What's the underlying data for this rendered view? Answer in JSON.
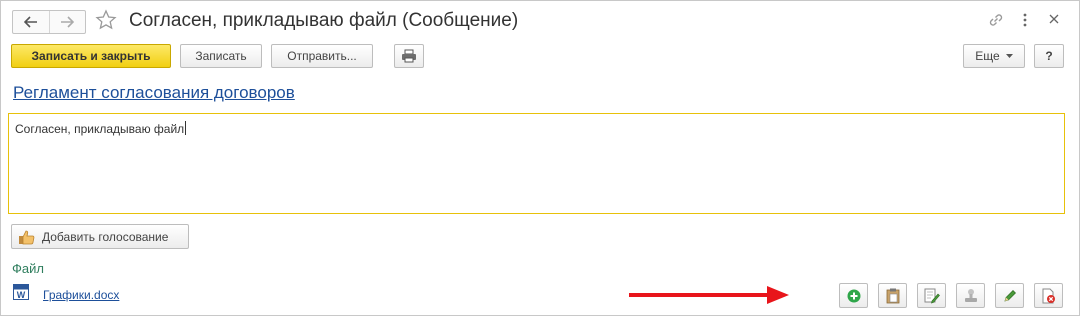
{
  "window": {
    "title": "Согласен, прикладываю файл (Сообщение)"
  },
  "toolbar": {
    "save_close_label": "Записать и закрыть",
    "save_label": "Записать",
    "send_label": "Отправить...",
    "more_label": "Еще",
    "help_label": "?"
  },
  "process": {
    "link_text": "Регламент согласования договоров"
  },
  "message": {
    "text": "Согласен, прикладываю файл"
  },
  "vote": {
    "button_label": "Добавить голосование"
  },
  "files": {
    "section_label": "Файл",
    "items": [
      {
        "name": "Графики.docx",
        "icon": "word-icon"
      }
    ]
  },
  "file_actions": [
    {
      "icon": "add-icon"
    },
    {
      "icon": "paste-icon"
    },
    {
      "icon": "edit-file-icon"
    },
    {
      "icon": "stamp-icon"
    },
    {
      "icon": "pencil-icon"
    },
    {
      "icon": "delete-file-icon"
    }
  ],
  "colors": {
    "primary_button": "#f1cf12",
    "link": "#1d4f9a",
    "focus_border": "#e7c10a",
    "section_label": "#2f7e5e",
    "annotation_arrow": "#e8151b"
  }
}
